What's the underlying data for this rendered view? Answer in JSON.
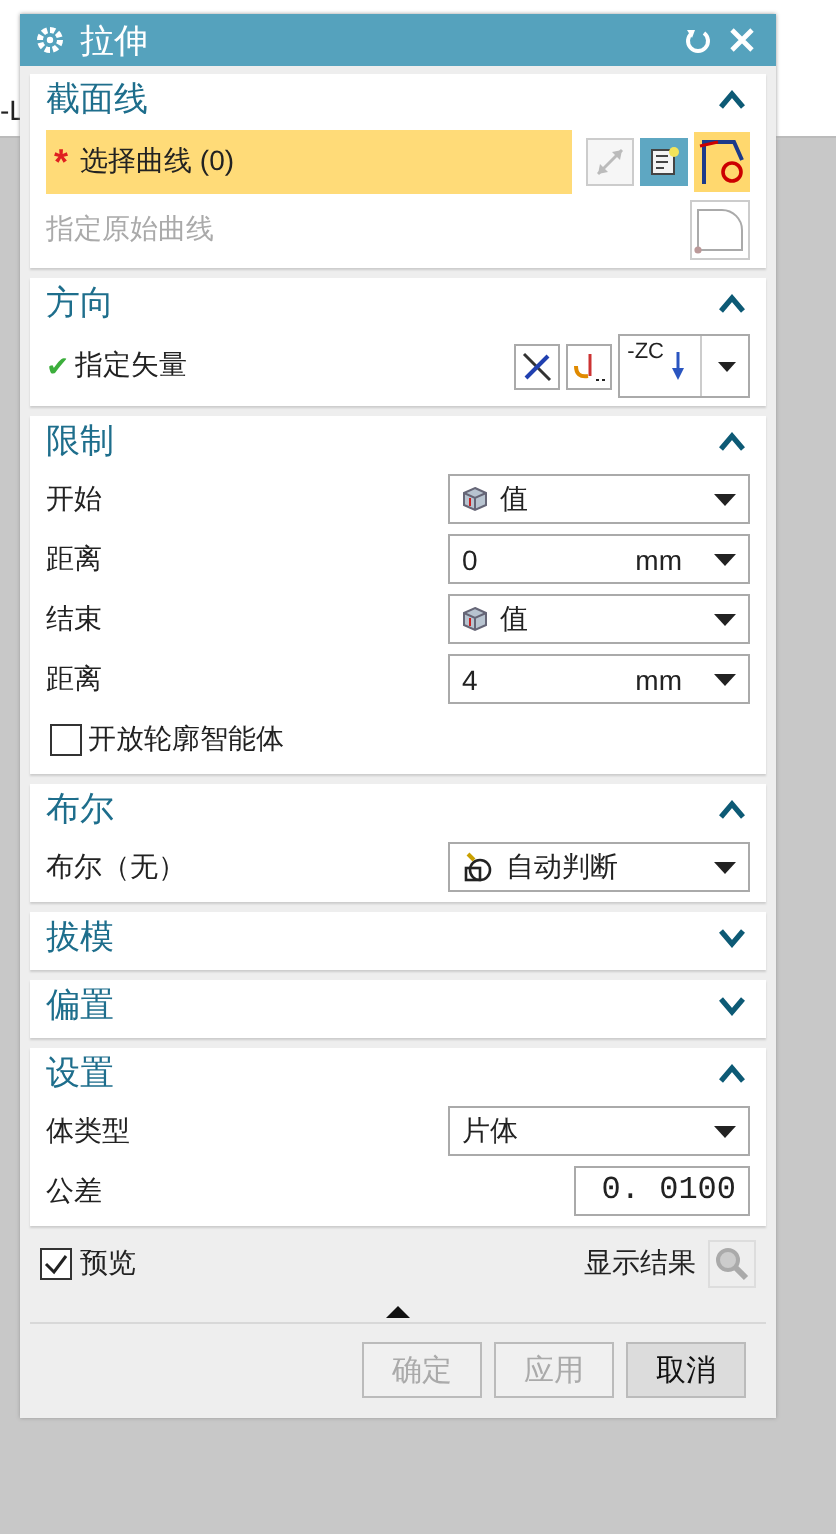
{
  "background_fragment": "-L",
  "window": {
    "title": "拉伸"
  },
  "sections": [
    {
      "title": "截面线",
      "expanded": true,
      "rows": [
        {
          "kind": "select",
          "marker": "*",
          "label": "选择曲线 (0)",
          "highlighted": true
        },
        {
          "kind": "hint",
          "label": "指定原始曲线",
          "disabled": true
        }
      ]
    },
    {
      "title": "方向",
      "expanded": true,
      "rows": [
        {
          "kind": "vector",
          "marker": "✔",
          "label": "指定矢量",
          "value": "-ZC"
        }
      ]
    },
    {
      "title": "限制",
      "expanded": true,
      "rows": [
        {
          "kind": "mode",
          "label": "开始",
          "value": "值"
        },
        {
          "kind": "measure",
          "label": "距离",
          "value": "0",
          "unit": "mm"
        },
        {
          "kind": "mode",
          "label": "结束",
          "value": "值"
        },
        {
          "kind": "measure",
          "label": "距离",
          "value": "4",
          "unit": "mm"
        },
        {
          "kind": "checkbox",
          "label": "开放轮廓智能体",
          "checked": false
        }
      ]
    },
    {
      "title": "布尔",
      "expanded": true,
      "rows": [
        {
          "kind": "boolean",
          "label": "布尔（无）",
          "value": "自动判断"
        }
      ]
    },
    {
      "title": "拔模",
      "expanded": false
    },
    {
      "title": "偏置",
      "expanded": false
    },
    {
      "title": "设置",
      "expanded": true,
      "rows": [
        {
          "kind": "type",
          "label": "体类型",
          "value": "片体"
        },
        {
          "kind": "number",
          "label": "公差",
          "value": "0. 0100"
        }
      ]
    }
  ],
  "footer": {
    "preview": {
      "label": "预览",
      "checked": true
    },
    "show_result": "显示结果"
  },
  "buttons": [
    {
      "label": "确定",
      "disabled": true
    },
    {
      "label": "应用",
      "disabled": true
    },
    {
      "label": "取消",
      "disabled": false
    }
  ]
}
